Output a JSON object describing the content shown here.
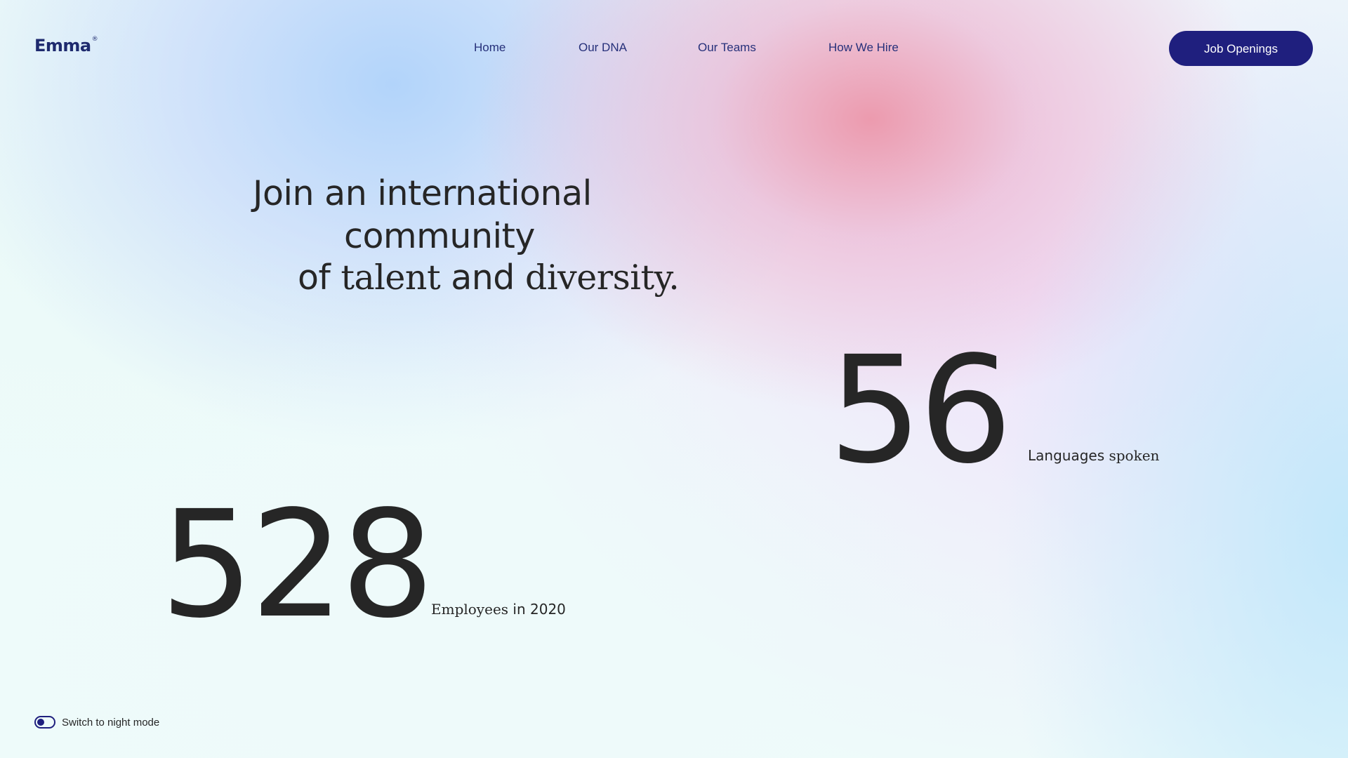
{
  "header": {
    "logo_text": "Emma",
    "logo_mark": "®",
    "nav": [
      {
        "label": "Home"
      },
      {
        "label": "Our DNA"
      },
      {
        "label": "Our Teams"
      },
      {
        "label": "How We Hire"
      }
    ],
    "cta_label": "Job Openings"
  },
  "hero": {
    "line1": "Join an international",
    "line2": "community",
    "line3_prefix": "of ",
    "line3_serif_a": "talent",
    "line3_middle": " and ",
    "line3_serif_b": "diversity."
  },
  "stats": {
    "languages": {
      "value": "56",
      "label_plain": "Languages ",
      "label_serif": "spoken"
    },
    "employees": {
      "value": "528",
      "label_serif": "Employees",
      "label_plain": " in 2020"
    }
  },
  "night_mode": {
    "label": "Switch to night mode",
    "enabled": false
  },
  "colors": {
    "accent": "#1f1f7e",
    "text": "#262626",
    "nav_text": "#26307a",
    "button_text": "#ffffff"
  }
}
